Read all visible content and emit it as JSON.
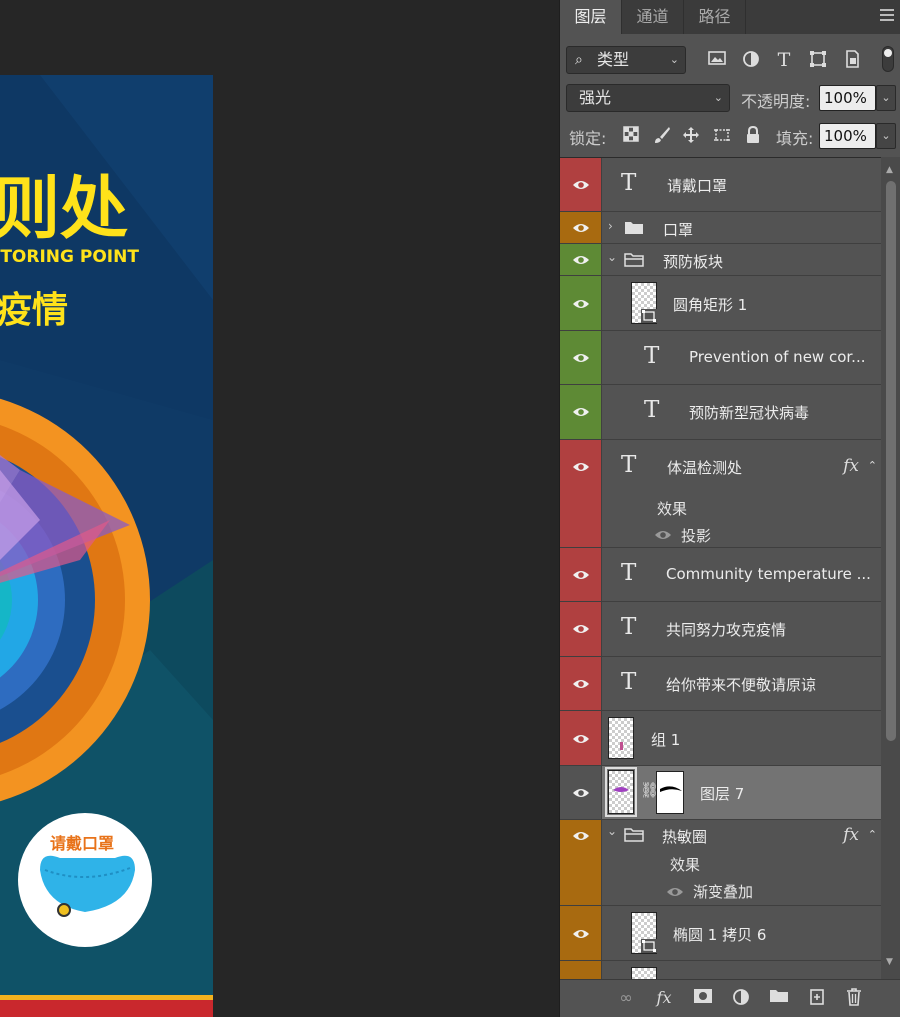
{
  "panel": {
    "tabs": [
      "图层",
      "通道",
      "路径"
    ],
    "filter": {
      "label": "类型"
    },
    "blend": {
      "mode": "强光",
      "opacity_label": "不透明度:",
      "opacity": "100%"
    },
    "lock": {
      "label": "锁定:",
      "fill_label": "填充:",
      "fill": "100%"
    }
  },
  "layers": [
    {
      "name": "请戴口罩",
      "kind": "text",
      "color": "#b04040"
    },
    {
      "name": "口罩",
      "kind": "group",
      "collapsed": true,
      "color": "#a86a10"
    },
    {
      "name": "预防板块",
      "kind": "group",
      "collapsed": false,
      "color": "#5e8a35"
    },
    {
      "name": "圆角矩形 1",
      "kind": "shape",
      "color": "#5e8a35"
    },
    {
      "name": "Prevention of new cor...",
      "kind": "text",
      "color": "#5e8a35"
    },
    {
      "name": "预防新型冠状病毒",
      "kind": "text",
      "color": "#5e8a35"
    },
    {
      "name": "体温检测处",
      "kind": "text",
      "color": "#b04040",
      "fx": "fx",
      "effects_label": "效果",
      "effect": "投影"
    },
    {
      "name": "Community temperature ...",
      "kind": "text",
      "color": "#b04040"
    },
    {
      "name": "共同努力攻克疫情",
      "kind": "text",
      "color": "#b04040"
    },
    {
      "name": "给你带来不便敬请原谅",
      "kind": "text",
      "color": "#b04040"
    },
    {
      "name": "组 1",
      "kind": "smart",
      "color": "#b04040"
    },
    {
      "name": "图层 7",
      "kind": "masked",
      "color": "#535353",
      "selected": true
    },
    {
      "name": "热敏圈",
      "kind": "group",
      "collapsed": false,
      "color": "#a86a10",
      "fx": "fx",
      "effects_label": "效果",
      "effect": "渐变叠加"
    },
    {
      "name": "椭圆 1 拷贝 6",
      "kind": "shape",
      "color": "#a86a10"
    }
  ],
  "artwork": {
    "title_fragment": "则处",
    "subtitle_fragment": "ITORING POINT",
    "slogan_fragment": "疫情",
    "badge_text": "请戴口罩"
  }
}
